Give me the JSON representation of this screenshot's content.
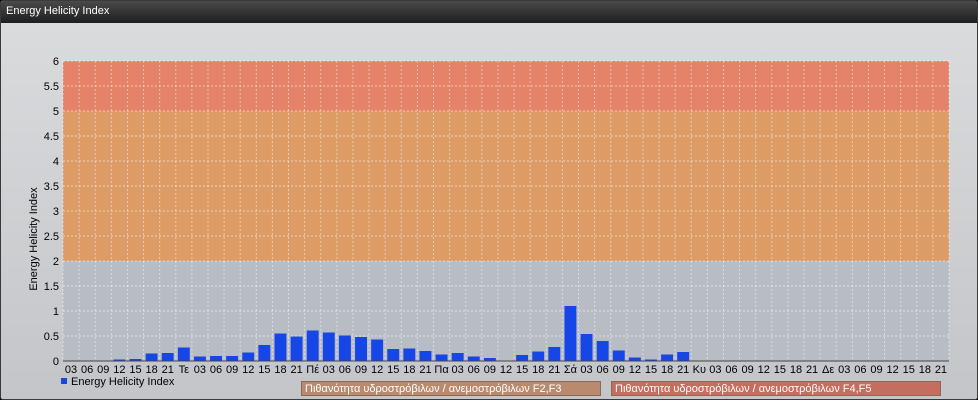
{
  "window": {
    "title": "Energy Helicity Index"
  },
  "colors": {
    "bar": "#1646e6",
    "band_high": "#e5826a",
    "band_mid": "#dd9c66",
    "band_low_grid": "#b8bcc4",
    "legend_f2f3": "#b98a6e",
    "legend_f4f5": "#c56e5f"
  },
  "legend": {
    "series_label": "Energy Helicity Index",
    "band_f2f3": "Πιθανότητα υδροστρόβιλων / ανεμοστρόβιλων F2,F3",
    "band_f4f5": "Πιθανότητα υδροστρόβιλων / ανεμοστρόβιλων F4,F5"
  },
  "chart_data": {
    "type": "bar",
    "ylabel": "Energy Helicity Index",
    "xlabel": "",
    "ylim": [
      0,
      6
    ],
    "yticks": [
      "0",
      "0.5",
      "1",
      "1.5",
      "2",
      "2.5",
      "3",
      "3.5",
      "4",
      "4.5",
      "5",
      "5.5",
      "6"
    ],
    "grid": true,
    "bands": [
      {
        "from": 2,
        "to": 5,
        "label": "Πιθανότητα υδροστρόβιλων / ανεμοστρόβιλων F2,F3"
      },
      {
        "from": 5,
        "to": 6,
        "label": "Πιθανότητα υδροστρόβιλων / ανεμοστρόβιλων F4,F5"
      }
    ],
    "categories": [
      "03",
      "06",
      "09",
      "12",
      "15",
      "18",
      "21",
      "Τε",
      "03",
      "06",
      "09",
      "12",
      "15",
      "18",
      "21",
      "Πέ",
      "03",
      "06",
      "09",
      "12",
      "15",
      "18",
      "21",
      "Πα",
      "03",
      "06",
      "09",
      "12",
      "15",
      "18",
      "21",
      "Σά",
      "03",
      "06",
      "09",
      "12",
      "15",
      "18",
      "21",
      "Κυ",
      "03",
      "06",
      "09",
      "12",
      "15",
      "18",
      "21",
      "Δε",
      "03",
      "06",
      "09",
      "12",
      "15",
      "18",
      "21"
    ],
    "series": [
      {
        "name": "Energy Helicity Index",
        "values": [
          0.01,
          0.01,
          0.01,
          0.03,
          0.04,
          0.15,
          0.16,
          0.27,
          0.09,
          0.1,
          0.1,
          0.17,
          0.32,
          0.55,
          0.49,
          0.61,
          0.57,
          0.51,
          0.48,
          0.43,
          0.24,
          0.25,
          0.2,
          0.13,
          0.16,
          0.09,
          0.06,
          0.01,
          0.12,
          0.19,
          0.28,
          1.1,
          0.54,
          0.4,
          0.21,
          0.07,
          0.03,
          0.13,
          0.18,
          0.01,
          0.01,
          0.01,
          0.01,
          0.01,
          0.01,
          0.01,
          0.01,
          0.01,
          0.01,
          0.01,
          0.01,
          0.01,
          0.01,
          0.01,
          0.01
        ]
      }
    ]
  }
}
